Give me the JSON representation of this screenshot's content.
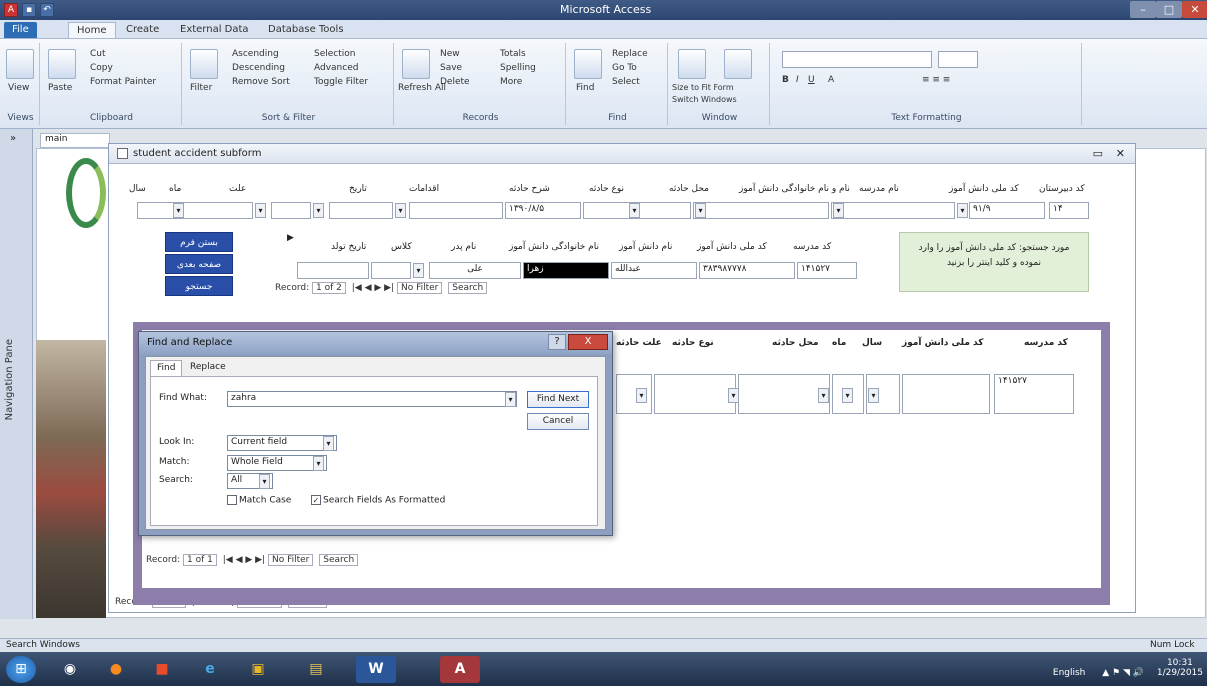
{
  "window": {
    "title": "Microsoft Access"
  },
  "ribbon": {
    "tabs": [
      "File",
      "Home",
      "Create",
      "External Data",
      "Database Tools"
    ],
    "groups": {
      "views": {
        "label": "Views",
        "view": "View"
      },
      "clipboard": {
        "label": "Clipboard",
        "cut": "Cut",
        "copy": "Copy",
        "paste": "Paste",
        "format_painter": "Format Painter"
      },
      "sort_filter": {
        "label": "Sort & Filter",
        "filter": "Filter",
        "ascending": "Ascending",
        "descending": "Descending",
        "remove_sort": "Remove Sort",
        "selection": "Selection",
        "advanced": "Advanced",
        "toggle_filter": "Toggle Filter"
      },
      "records": {
        "label": "Records",
        "refresh": "Refresh All",
        "new": "New",
        "save": "Save",
        "delete": "Delete",
        "totals": "Totals",
        "spelling": "Spelling",
        "more": "More"
      },
      "find": {
        "label": "Find",
        "find": "Find",
        "replace": "Replace",
        "goto": "Go To",
        "select": "Select"
      },
      "window": {
        "label": "Window",
        "size_to_fit": "Size to Fit Form",
        "switch_windows": "Switch Windows"
      },
      "text_formatting": {
        "label": "Text Formatting"
      }
    }
  },
  "nav_pane": {
    "label": "Navigation Pane"
  },
  "document": {
    "tab_label": "main"
  },
  "subform": {
    "title": "student accident subform",
    "header_labels": [
      "کد دبیرستان",
      "کد ملی دانش آموز",
      "نام و نام خانوادگی دانش آموز",
      "محل حادثه",
      "نوع حادثه",
      "شرح حادثه",
      "اقدامات",
      "تاریخ",
      "علت",
      "ماه",
      "سال",
      "نام مدرسه"
    ],
    "top_values": [
      "۱۴",
      "۹۱/۹",
      "۱۳۹۰/۸/۵"
    ],
    "buttons": [
      "بستن فرم",
      "صفحه بعدی",
      "جستجو"
    ],
    "list_headers": [
      "کد مدرسه",
      "کد ملی دانش آموز",
      "نام دانش آموز",
      "نام خانوادگی دانش آموز",
      "نام پدر",
      "کلاس",
      "تاریخ تولد"
    ],
    "list_values": [
      "۱۴۱۵۲۷",
      "۳۸۳۹۸۷۷۷۸",
      "عبدالله",
      "زهرا",
      "علی"
    ],
    "search_panel_text": "مورد جستجو: کد ملی دانش آموز را وارد نموده و کلید اینتر را بزنید",
    "list_nav": {
      "record": "Record:",
      "pos": "1 of 2",
      "filter": "No Filter",
      "search": "Search"
    },
    "bottom_nav": {
      "record": "Record:",
      "pos": "1 of 1",
      "filter": "No Filter",
      "search": "Search"
    }
  },
  "inner_subform": {
    "headers": [
      "کد مدرسه",
      "کد ملی دانش آموز",
      "سال",
      "ماه",
      "محل حادثه",
      "نوع حادثه",
      "علت حادثه"
    ],
    "first_value": "۱۴۱۵۲۷",
    "nav": {
      "record": "Record:",
      "pos": "1 of 1",
      "filter": "No Filter",
      "search": "Search"
    }
  },
  "find_dialog": {
    "title": "Find and Replace",
    "tabs": [
      "Find",
      "Replace"
    ],
    "find_what_label": "Find What:",
    "find_what_value": "zahra",
    "look_in_label": "Look In:",
    "look_in_value": "Current field",
    "match_label": "Match:",
    "match_value": "Whole Field",
    "search_label": "Search:",
    "search_value": "All",
    "match_case": "Match Case",
    "search_formatted": "Search Fields As Formatted",
    "find_next": "Find Next",
    "cancel": "Cancel",
    "help": "?",
    "close": "X"
  },
  "statusbar": {
    "left": "Search Windows",
    "right": "Num Lock"
  },
  "taskbar": {
    "lang": "English",
    "time": "10:31",
    "date": "1/29/2015"
  }
}
